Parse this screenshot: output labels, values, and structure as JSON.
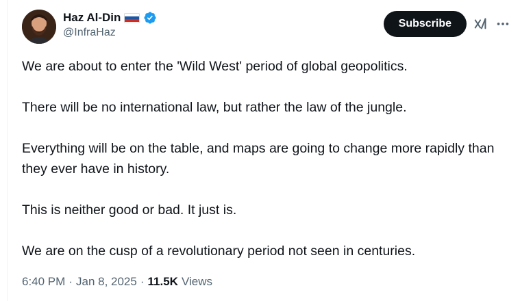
{
  "author": {
    "display_name": "Haz Al-Din",
    "handle": "@InfraHaz",
    "flag_colors": [
      "#ffffff",
      "#1c57a5",
      "#d52b1e"
    ],
    "verified_color": "#1d9bf0"
  },
  "actions": {
    "subscribe_label": "Subscribe",
    "grok_icon": "grok-icon",
    "more_icon": "more-icon"
  },
  "tweet": {
    "paragraphs": [
      "We are about to enter the 'Wild West' period of global geopolitics.",
      "There will be no international law, but rather the law of the jungle.",
      "Everything will be on the table, and maps are going to change more rapidly than they ever have in history.",
      "This is neither good or bad. It just is.",
      "We are on the cusp of a revolutionary period not seen in centuries."
    ]
  },
  "meta": {
    "time": "6:40 PM",
    "date": "Jan 8, 2025",
    "separator": "·",
    "views_count": "11.5K",
    "views_label": "Views"
  }
}
